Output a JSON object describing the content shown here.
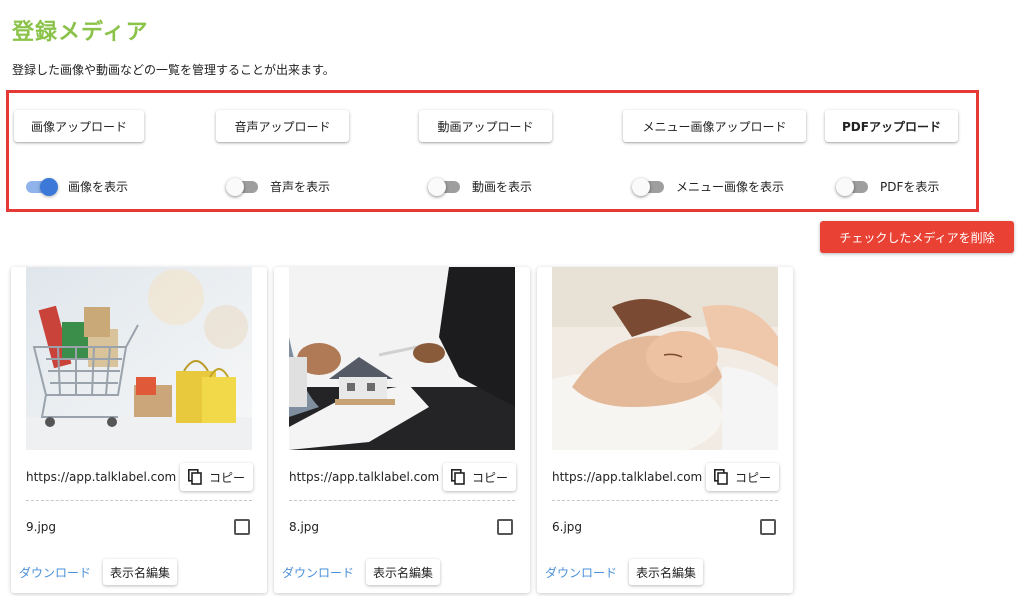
{
  "page": {
    "title": "登録メディア",
    "description": "登録した画像や動画などの一覧を管理することが出来ます。"
  },
  "upload_buttons": [
    {
      "label": "画像アップロード"
    },
    {
      "label": "音声アップロード"
    },
    {
      "label": "動画アップロード"
    },
    {
      "label": "メニュー画像アップロード"
    },
    {
      "label": "PDFアップロード"
    }
  ],
  "toggles": [
    {
      "label": "画像を表示",
      "on": true
    },
    {
      "label": "音声を表示",
      "on": false
    },
    {
      "label": "動画を表示",
      "on": false
    },
    {
      "label": "メニュー画像を表示",
      "on": false
    },
    {
      "label": "PDFを表示",
      "on": false
    }
  ],
  "delete_button": {
    "label": "チェックしたメディアを削除"
  },
  "colors": {
    "title": "#8bc34a",
    "panel_border": "#e53935",
    "danger": "#e94235",
    "link": "#4a90d9",
    "toggle_on": "#3c78d8"
  },
  "media_cards": [
    {
      "url": "https://app.talklabel.com",
      "copy_label": "コピー",
      "copy_icon": "copy-icon",
      "file_name": "9.jpg",
      "checked": false,
      "download_label": "ダウンロード",
      "rename_label": "表示名編集"
    },
    {
      "url": "https://app.talklabel.com",
      "copy_label": "コピー",
      "copy_icon": "copy-icon",
      "file_name": "8.jpg",
      "checked": false,
      "download_label": "ダウンロード",
      "rename_label": "表示名編集"
    },
    {
      "url": "https://app.talklabel.com",
      "copy_label": "コピー",
      "copy_icon": "copy-icon",
      "file_name": "6.jpg",
      "checked": false,
      "download_label": "ダウンロード",
      "rename_label": "表示名編集"
    }
  ]
}
